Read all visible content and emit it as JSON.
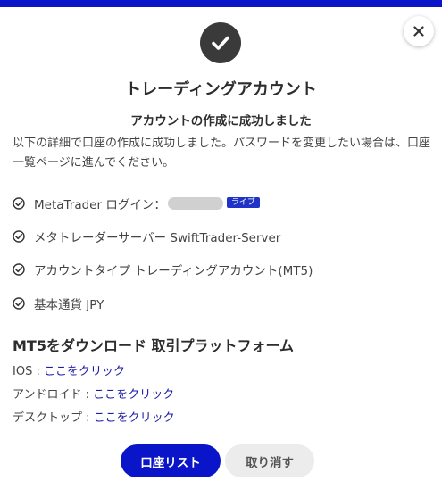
{
  "colors": {
    "accent": "#0a14c8",
    "link": "#1b1aa8",
    "badge": "#1f33c6"
  },
  "icons": {
    "close": "close-icon",
    "success": "checkmark-circle-icon",
    "list_check": "check-circle-icon"
  },
  "dialog": {
    "title": "トレーディングアカウント",
    "subtitle": "アカウントの作成に成功しました",
    "description": "以下の詳細で口座の作成に成功しました。パスワードを変更したい場合は、口座一覧ページに進んでください。"
  },
  "details": {
    "login_label": "MetaTrader ログイン：",
    "live_badge": "ライブ",
    "server": "メタトレーダーサーバー SwiftTrader-Server",
    "account_type": "アカウントタイプ トレーディングアカウント(MT5)",
    "currency": "基本通貨 JPY"
  },
  "download": {
    "title": "MT5をダウンロード 取引プラットフォーム",
    "ios_label": "IOS : ",
    "ios_link": "ここをクリック",
    "android_label": "アンドロイド : ",
    "android_link": "ここをクリック",
    "desktop_label": "デスクトップ : ",
    "desktop_link": "ここをクリック"
  },
  "buttons": {
    "account_list": "口座リスト",
    "cancel": "取り消す"
  }
}
